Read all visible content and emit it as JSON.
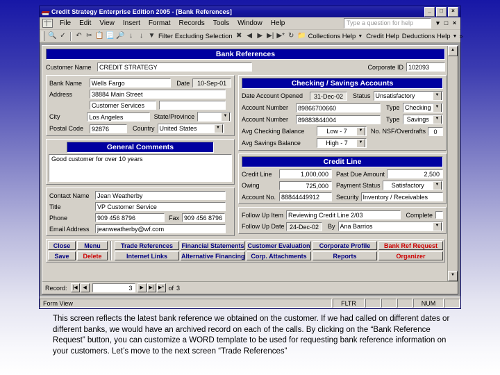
{
  "window": {
    "title": "Credit Strategy Enterprise Edition 2005 - [Bank References]",
    "min": "_",
    "restore": "□",
    "close": "×",
    "mdi_min": "▾",
    "mdi_restore": "□",
    "mdi_close": "×"
  },
  "menu": {
    "items": [
      "File",
      "Edit",
      "View",
      "Insert",
      "Format",
      "Records",
      "Tools",
      "Window",
      "Help"
    ],
    "ask_placeholder": "Type a question for help"
  },
  "toolbar": {
    "filter_label": "Filter Excluding Selection",
    "help_items": [
      "Collections Help",
      "Credit Help",
      "Deductions Help"
    ],
    "overflow": "»"
  },
  "form": {
    "banner": "Bank References",
    "customer_name_label": "Customer Name",
    "customer_name": "CREDIT STRATEGY",
    "corporate_id_label": "Corporate ID",
    "corporate_id": "102093"
  },
  "bank": {
    "bank_name_label": "Bank Name",
    "bank_name": "Wells Fargo",
    "date_label": "Date",
    "date": "10-Sep-01",
    "address_label": "Address",
    "address1": "38884 Main Street",
    "address2": "Customer Services",
    "address3": "",
    "city_label": "City",
    "city": "Los Angeles",
    "state_label": "State/Province",
    "state": "",
    "postal_label": "Postal Code",
    "postal": "92876",
    "country_label": "Country",
    "country": "United States"
  },
  "comments": {
    "banner": "General Comments",
    "text": "Good customer for over 10 years"
  },
  "contact": {
    "name_label": "Contact Name",
    "name": "Jean Weatherby",
    "title_label": "Title",
    "title": "VP Customer Service",
    "phone_label": "Phone",
    "phone": "909 456 8796",
    "fax_label": "Fax",
    "fax": "909 456 8796",
    "email_label": "Email Address",
    "email": "jeanweatherby@wf.com"
  },
  "accounts": {
    "banner": "Checking / Savings Accounts",
    "date_opened_label": "Date Account Opened",
    "date_opened": "31-Dec-02",
    "status_label": "Status",
    "status": "Unsatisfactory",
    "acct1_label": "Account Number",
    "acct1": "89866700660",
    "type1_label": "Type",
    "type1": "Checking",
    "acct2_label": "Account Number",
    "acct2": "89883844004",
    "type2_label": "Type",
    "type2": "Savings",
    "avg_checking_label": "Avg Checking  Balance",
    "avg_checking": "Low - 7",
    "nsf_label": "No. NSF/Overdrafts",
    "nsf": "0",
    "avg_savings_label": "Avg Savings Balance",
    "avg_savings": "High - 7"
  },
  "creditline": {
    "banner": "Credit Line",
    "credit_line_label": "Credit Line",
    "credit_line": "1,000,000",
    "past_due_label": "Past Due Amount",
    "past_due": "2,500",
    "owing_label": "Owing",
    "owing": "725,000",
    "payment_status_label": "Payment Status",
    "payment_status": "Satisfactory",
    "account_no_label": "Account No.",
    "account_no": "88844449912",
    "security_label": "Security",
    "security": "Inventory / Receivables"
  },
  "followup": {
    "item_label": "Follow Up Item",
    "item": "Reviewing Credit Line 2/03",
    "complete_label": "Complete",
    "date_label": "Follow Up Date",
    "date": "24-Dec-02",
    "by_label": "By",
    "by": "Ana Barrios"
  },
  "buttons": {
    "close": "Close",
    "menu": "Menu",
    "save": "Save",
    "delete": "Delete",
    "row1": [
      "Trade References",
      "Financial Statements",
      "Customer Evaluation",
      "Corporate Profile",
      "Bank Ref Request"
    ],
    "row2": [
      "Internet Links",
      "Alternative Financing",
      "Corp. Attachments",
      "Reports",
      "Organizer"
    ]
  },
  "record": {
    "label": "Record:",
    "first": "⏮",
    "prev": "◀",
    "value": "3",
    "next": "▶",
    "last": "⏭",
    "new": "▶*",
    "of_label": "of",
    "total": "3"
  },
  "status": {
    "view": "Form View",
    "fltr": "FLTR",
    "num": "NUM"
  },
  "caption": {
    "text": "This screen reflects the latest bank reference we obtained on the customer. If we had called on different dates or different banks, we would have an archived record on each of the calls. By clicking on the “Bank Reference Request” button, you can customize a WORD template to be used for requesting bank reference information on your customers. Let’s move to the next screen “Trade References”"
  },
  "colors": {
    "banner_blue": "#0000a0",
    "title_blue": "#1616a0",
    "button_text": "#000080",
    "button_red": "#cc0000",
    "face": "#d4d0c8"
  }
}
